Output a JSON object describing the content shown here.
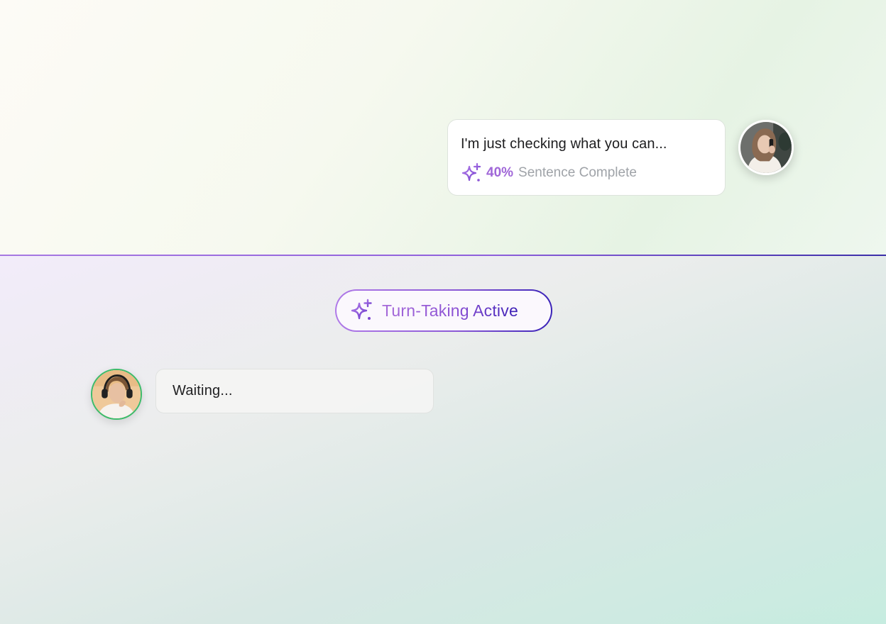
{
  "incoming_message": {
    "text": "I'm just checking what you can...",
    "progress_value": "40%",
    "progress_label": "Sentence Complete"
  },
  "status_badge": {
    "label": "Turn-Taking Active"
  },
  "reply_bubble": {
    "text": "Waiting..."
  },
  "icons": {
    "progress": "sparkle-icon",
    "badge": "sparkle-icon"
  },
  "colors": {
    "accent_purple": "#a067d8",
    "accent_indigo": "#3a23b8",
    "divider_start": "#a678e2",
    "divider_end": "#3b2ea8",
    "avatar_ring_green": "#3dbb6a",
    "muted_text": "#9fa3a8"
  }
}
